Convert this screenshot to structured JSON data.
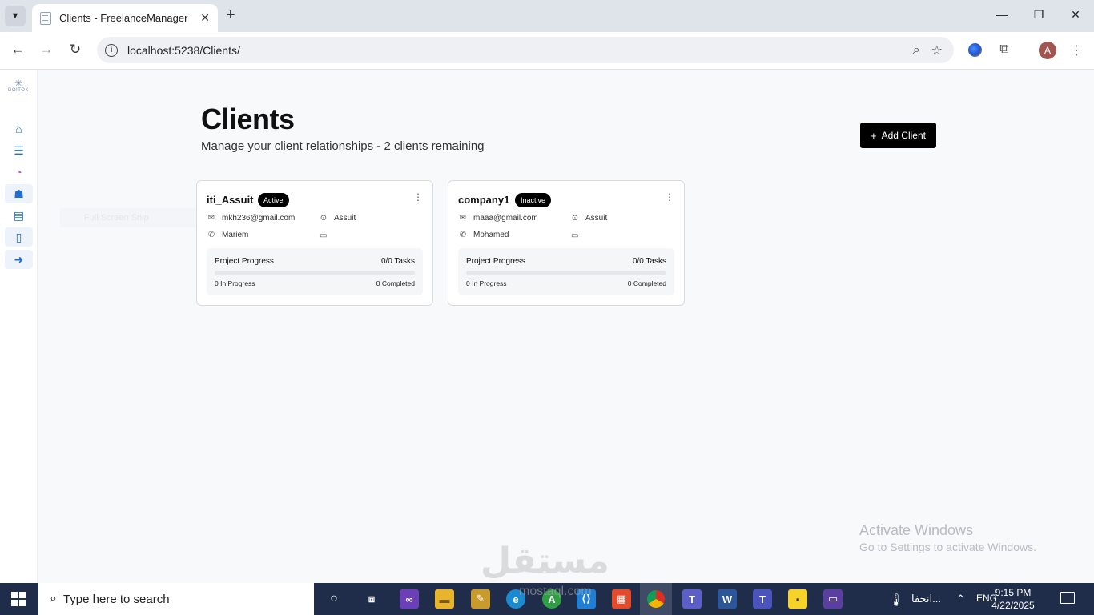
{
  "browser": {
    "tab_title": "Clients - FreelanceManager",
    "tab_close": "✕",
    "new_tab": "+",
    "url": "localhost:5238/Clients/",
    "window_controls": {
      "minimize": "—",
      "restore": "❐",
      "close": "✕"
    },
    "avatar_initial": "A"
  },
  "sidebar": {
    "logo_text": "DOITOK",
    "items": [
      {
        "icon": "home-icon",
        "glyph": "⌂"
      },
      {
        "icon": "list-icon",
        "glyph": "☰"
      },
      {
        "icon": "timer-icon",
        "glyph": "◔"
      },
      {
        "icon": "clients-icon",
        "glyph": "☗"
      },
      {
        "icon": "projects-icon",
        "glyph": "▤"
      },
      {
        "icon": "document-icon",
        "glyph": "▯"
      },
      {
        "icon": "logout-icon",
        "glyph": "➜"
      }
    ],
    "faint_menu_label": "Full Screen Snip"
  },
  "header": {
    "title": "Clients",
    "subtitle": "Manage your client relationships - 2 clients remaining",
    "add_button_label": "Add Client",
    "add_button_plus": "+"
  },
  "clients": [
    {
      "name": "iti_Assuit",
      "status": "Active",
      "email": "mkh236@gmail.com",
      "location": "Assuit",
      "contact": "Mariem",
      "progress_label": "Project Progress",
      "tasks": "0/0 Tasks",
      "progress_fraction": 0,
      "in_progress": "0 In Progress",
      "completed": "0 Completed"
    },
    {
      "name": "company1",
      "status": "Inactive",
      "email": "maaa@gmail.com",
      "location": "Assuit",
      "contact": "Mohamed",
      "progress_label": "Project Progress",
      "tasks": "0/0 Tasks",
      "progress_fraction": 0,
      "in_progress": "0 In Progress",
      "completed": "0 Completed"
    }
  ],
  "overlay": {
    "activate_line1": "Activate Windows",
    "activate_line2": "Go to Settings to activate Windows.",
    "watermark": "مستقل",
    "watermark_url": "mostaql.com"
  },
  "taskbar": {
    "search_placeholder": "Type here to search",
    "weather_text": "انخفا...",
    "language": "ENG",
    "time": "9:15 PM",
    "date": "4/22/2025"
  }
}
